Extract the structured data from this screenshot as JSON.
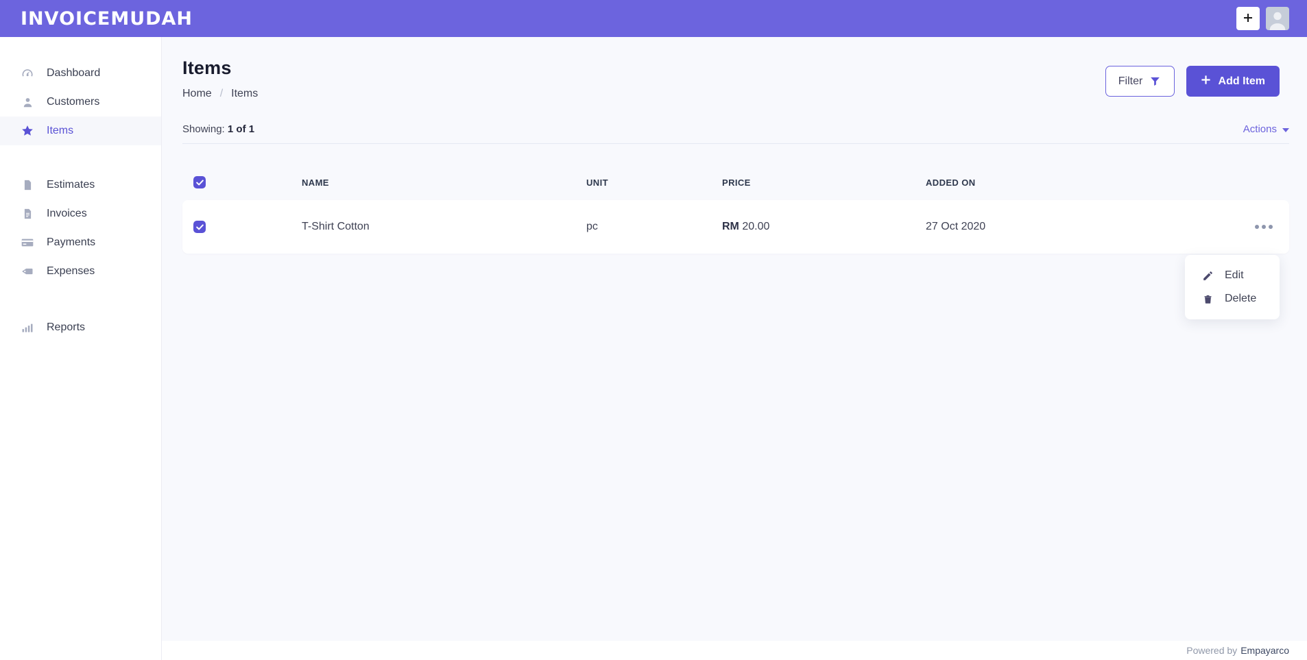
{
  "header": {
    "logo": "INVOICEMUDAH"
  },
  "sidebar": {
    "items": [
      {
        "label": "Dashboard",
        "icon": "gauge-icon",
        "active": false
      },
      {
        "label": "Customers",
        "icon": "user-icon",
        "active": false
      },
      {
        "label": "Items",
        "icon": "star-icon",
        "active": true
      },
      {
        "label": "Estimates",
        "icon": "file-icon",
        "active": false
      },
      {
        "label": "Invoices",
        "icon": "file-text-icon",
        "active": false
      },
      {
        "label": "Payments",
        "icon": "credit-card-icon",
        "active": false
      },
      {
        "label": "Expenses",
        "icon": "tag-icon",
        "active": false
      },
      {
        "label": "Reports",
        "icon": "bar-chart-icon",
        "active": false
      }
    ]
  },
  "page": {
    "title": "Items",
    "breadcrumb": {
      "home": "Home",
      "separator": "/",
      "current": "Items"
    },
    "filter_label": "Filter",
    "add_item_label": "Add Item",
    "showing_label": "Showing:",
    "showing_count": "1 of 1",
    "actions_label": "Actions"
  },
  "table": {
    "headers": [
      "NAME",
      "UNIT",
      "PRICE",
      "ADDED ON"
    ],
    "rows": [
      {
        "checked": true,
        "name": "T-Shirt Cotton",
        "unit": "pc",
        "currency": "RM",
        "price": "20.00",
        "added_on": "27 Oct 2020"
      }
    ]
  },
  "row_menu": {
    "items": [
      {
        "label": "Edit",
        "icon": "pencil-icon"
      },
      {
        "label": "Delete",
        "icon": "trash-icon"
      }
    ]
  },
  "footer": {
    "powered_by": "Powered by",
    "brand": "Empayarco"
  },
  "colors": {
    "header_bg": "#6c64de",
    "accent": "#5a52d6",
    "page_bg": "#f8f9fd",
    "text_dark": "#3f4254",
    "table_header_text": "#2e384d",
    "muted_icon": "#a6acbf",
    "divider": "#e4e9f2",
    "footer_muted": "#9098a9",
    "footer_brand": "#3d4863"
  }
}
